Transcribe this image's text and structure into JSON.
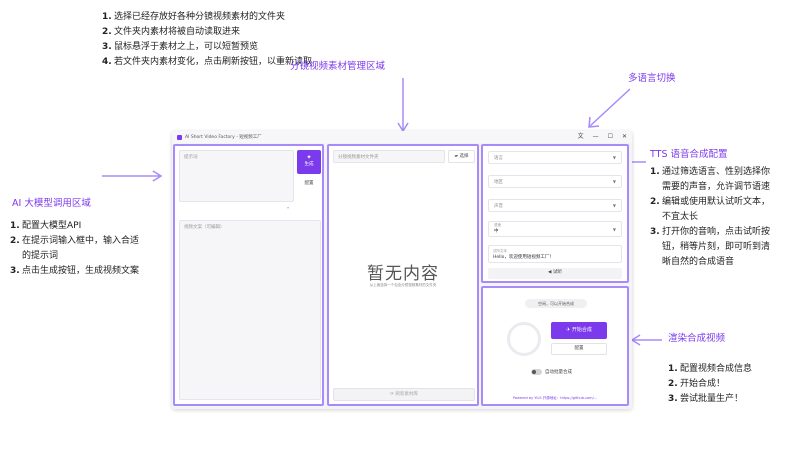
{
  "annotations": {
    "top_instructions": [
      {
        "num": "1.",
        "text": "选择已经存放好各种分镜视频素材的文件夹"
      },
      {
        "num": "2.",
        "text": "文件夹内素材将被自动读取进来"
      },
      {
        "num": "3.",
        "text": "鼠标悬浮于素材之上，可以短暂预览"
      },
      {
        "num": "4.",
        "text": "若文件夹内素材变化，点击刷新按钮，以重新读取"
      }
    ],
    "material_area_title": "分镜视频素材管理区域",
    "language_switch_title": "多语言切换",
    "tts_title": "TTS 语音合成配置",
    "tts_steps": [
      {
        "num": "1.",
        "text": "通过筛选语言、性别选择你"
      },
      {
        "num": "",
        "text": "需要的声音，允许调节语速"
      },
      {
        "num": "2.",
        "text": "编辑或使用默认试听文本，"
      },
      {
        "num": "",
        "text": "不宜太长"
      },
      {
        "num": "3.",
        "text": "打开你的音响，点击试听按"
      },
      {
        "num": "",
        "text": "钮，稍等片刻，即可听到清"
      },
      {
        "num": "",
        "text": "晰自然的合成语音"
      }
    ],
    "llm_title": "AI 大模型调用区域",
    "llm_steps": [
      {
        "num": "1.",
        "text": "配置大模型API"
      },
      {
        "num": "2.",
        "text": "在提示词输入框中，输入合适"
      },
      {
        "num": "",
        "text": "的提示词"
      },
      {
        "num": "3.",
        "text": "点击生成按钮，生成视频文案"
      }
    ],
    "render_title": "渲染合成视频",
    "render_steps": [
      {
        "num": "1.",
        "text": "配置视频合成信息"
      },
      {
        "num": "2.",
        "text": "开始合成！"
      },
      {
        "num": "3.",
        "text": "尝试批量生产！"
      }
    ]
  },
  "window": {
    "title": "AI Short Video Factory - 短视频工厂",
    "controls": [
      "文",
      "—",
      "☐",
      "✕"
    ]
  },
  "left_panel": {
    "prompt_placeholder": "提示词",
    "generate_label": "生成",
    "config_label": "配置",
    "copy_placeholder": "视频文案（可编辑）"
  },
  "middle_panel": {
    "folder_placeholder": "分镜视频素材文件夹",
    "select_label": "选择",
    "empty_title": "暂无内容",
    "empty_hint": "从上面选择一个包含分镜视频素材的文件夹",
    "refresh_label": "刷新素材库"
  },
  "tts_panel": {
    "language": "语言",
    "region": "地区",
    "voice": "声音",
    "speed_label": "语速",
    "speed_value": "中",
    "sample_label": "试听文本",
    "sample_text": "Hello，欢迎使用短视频工厂！",
    "listen_label": "试听"
  },
  "render_panel": {
    "status": "空闲，可以开始合成",
    "start_label": "开始合成",
    "config_label": "配置",
    "batch_label": "自动批量合成",
    "footer": "Powered by YILS 开源地址：https://github.com/..."
  },
  "colors": {
    "accent": "#7c3aed",
    "arrow": "#a78bfa"
  }
}
